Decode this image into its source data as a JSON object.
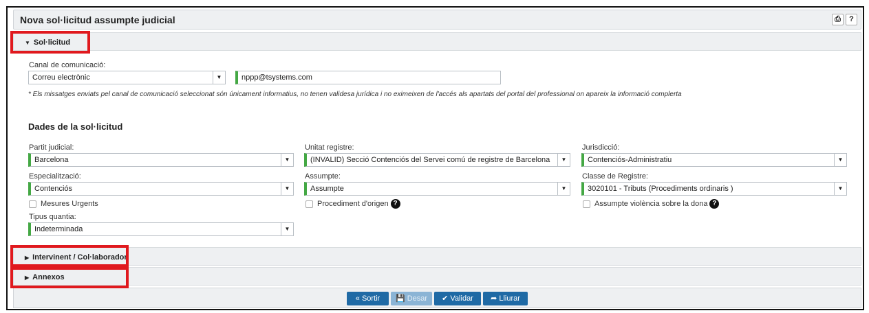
{
  "title": "Nova sol·licitud assumpte judicial",
  "icons": {
    "print": "print-icon",
    "help": "help-icon"
  },
  "sections": {
    "solicitud": "Sol·licitud",
    "interv": "Intervinent / Col·laborador",
    "annexos": "Annexos"
  },
  "canal": {
    "label": "Canal de comunicació:",
    "value": "Correu electrònic",
    "email": "nppp@tsystems.com"
  },
  "note": "* Els missatges enviats pel canal de comunicació seleccionat són únicament informatius, no tenen validesa jurídica i no eximeixen de l'accés als apartats del portal del professional on apareix la informació complerta",
  "dades": "Dades de la sol·licitud",
  "fields": {
    "partit": {
      "label": "Partit judicial:",
      "value": "Barcelona"
    },
    "unitat": {
      "label": "Unitat registre:",
      "value": "(INVALID) Secció Contenciós del Servei comú de registre de Barcelona"
    },
    "juris": {
      "label": "Jurisdicció:",
      "value": "Contenciós-Administratiu"
    },
    "espec": {
      "label": "Especialització:",
      "value": "Contenciós"
    },
    "assumpte": {
      "label": "Assumpte:",
      "value": "Assumpte"
    },
    "classe": {
      "label": "Classe de Registre:",
      "value": "3020101 - Tributs (Procediments ordinaris )"
    },
    "quantia": {
      "label": "Tipus quantia:",
      "value": "Indeterminada"
    }
  },
  "checks": {
    "mesures": "Mesures Urgents",
    "procediment": "Procediment d'origen",
    "violencia": "Assumpte violència sobre la dona"
  },
  "buttons": {
    "sortir": "« Sortir",
    "desar": "Desar",
    "validar": "Validar",
    "lliurar": "Lliurar"
  },
  "colors": {
    "accent": "#1f6aa5",
    "valid": "#44a844",
    "highlight": "#e0191e"
  }
}
